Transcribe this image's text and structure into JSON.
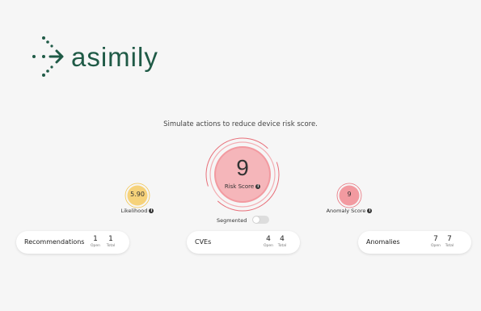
{
  "brand": {
    "name": "asimily",
    "color": "#1f5a46"
  },
  "subtitle": "Simulate actions to reduce device risk score.",
  "risk": {
    "value": "9",
    "label": "Risk Score",
    "color": "#e8707a"
  },
  "likelihood": {
    "value": "5.90",
    "label": "Likelihood",
    "color": "#f2c54e"
  },
  "anomaly_score": {
    "value": "9",
    "label": "Anomaly Score",
    "color": "#e8707a"
  },
  "segmented": {
    "label": "Segmented",
    "on": false
  },
  "cards": [
    {
      "title": "Recommendations",
      "open": "1",
      "total": "1",
      "open_label": "Open",
      "total_label": "Total"
    },
    {
      "title": "CVEs",
      "open": "4",
      "total": "4",
      "open_label": "Open",
      "total_label": "Total"
    },
    {
      "title": "Anomalies",
      "open": "7",
      "total": "7",
      "open_label": "Open",
      "total_label": "Total"
    }
  ]
}
